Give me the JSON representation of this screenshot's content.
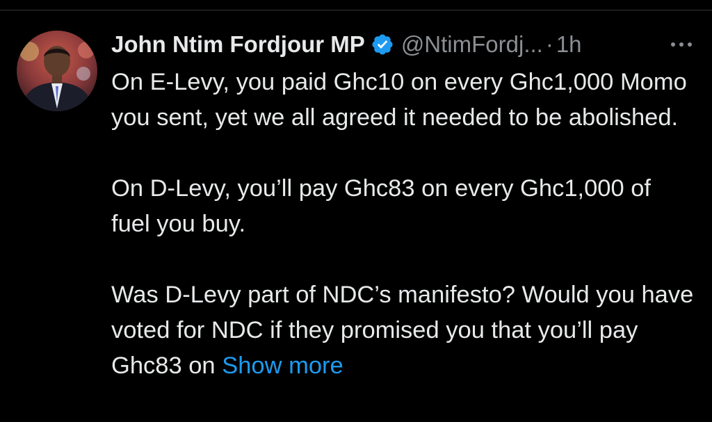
{
  "tweet": {
    "author_name": "John Ntim Fordjour MP",
    "handle": "@NtimFordj...",
    "separator": "·",
    "time": "1h",
    "paragraphs": [
      "On E-Levy, you paid Ghc10 on every Ghc1,000 Momo you sent, yet we all agreed it needed to be abolished.",
      "On D-Levy, you’ll pay Ghc83 on every Ghc1,000 of fuel you buy.",
      "Was D-Levy part of NDC’s manifesto? Would you have voted for NDC if they promised you that you’ll pay Ghc83 on "
    ],
    "show_more_label": "Show more",
    "icons": {
      "verified": "verified-badge-icon",
      "more": "more-options-icon"
    }
  },
  "colors": {
    "background": "#000000",
    "text": "#e7e9ea",
    "secondary": "#8b8f93",
    "link": "#1d9bf0",
    "verified": "#1d9bf0"
  }
}
